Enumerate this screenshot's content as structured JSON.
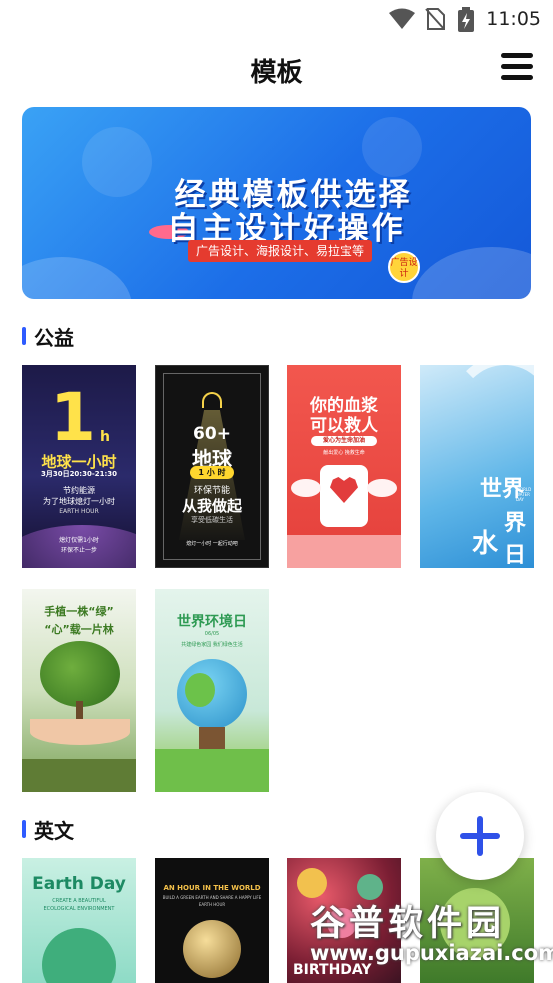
{
  "status_bar": {
    "time": "11:05"
  },
  "header": {
    "title": "模板"
  },
  "banner": {
    "line1": "经典模板供选择",
    "line2": "自主设计好操作",
    "ribbon": "广告设计、海报设计、易拉宝等",
    "badge": "广告设计"
  },
  "sections": [
    {
      "label": "公益",
      "tiles": [
        {
          "big": "1",
          "sub": "h",
          "title": "地球一小时",
          "date": "3月30日20:30-21:30",
          "line1": "节约能源",
          "line2": "为了地球熄灯一小时",
          "line3": "EARTH HOUR",
          "foot1": "熄灯仅需1小时",
          "foot2": "环保不止一步"
        },
        {
          "big": "60+",
          "title": "地球",
          "badge": "1 小 时",
          "line1": "环保节能",
          "line2": "从我做起",
          "line3": "享受低碳生活",
          "foot": "熄灯一小时     一起行动吧"
        },
        {
          "title1": "你的血浆",
          "title2": "可以救人",
          "line1": "爱心为生命加油",
          "line2": "献出爱心 挽救生命"
        },
        {
          "t1": "世界",
          "t2": "水",
          "t3": "界",
          "t4": "日",
          "small": "WORLD WATER DAY"
        },
        {
          "line1": "手植一株“绿”",
          "line2": "“心”载一片林"
        },
        {
          "title": "世界环境日",
          "sub": "06/05",
          "line": "共建绿色家园  我们绿色生活"
        }
      ]
    },
    {
      "label": "英文",
      "tiles": [
        {
          "title": "Earth Day",
          "line1": "CREATE A BEAUTIFUL",
          "line2": "ECOLOGICAL ENVIRONMENT"
        },
        {
          "title": "AN HOUR IN THE WORLD",
          "line1": "BUILD A GREEN EARTH AND SHARE A HAPPY LIFE",
          "line2": "EARTH HOUR"
        },
        {
          "title": "BIRTHDAY"
        },
        {
          "title": ""
        }
      ]
    }
  ],
  "watermark": {
    "text": "谷普软件园",
    "url": "www.gupuxiazai.com"
  },
  "colors": {
    "accent": "#2f51e8",
    "section_bar": "#2e5bff"
  }
}
